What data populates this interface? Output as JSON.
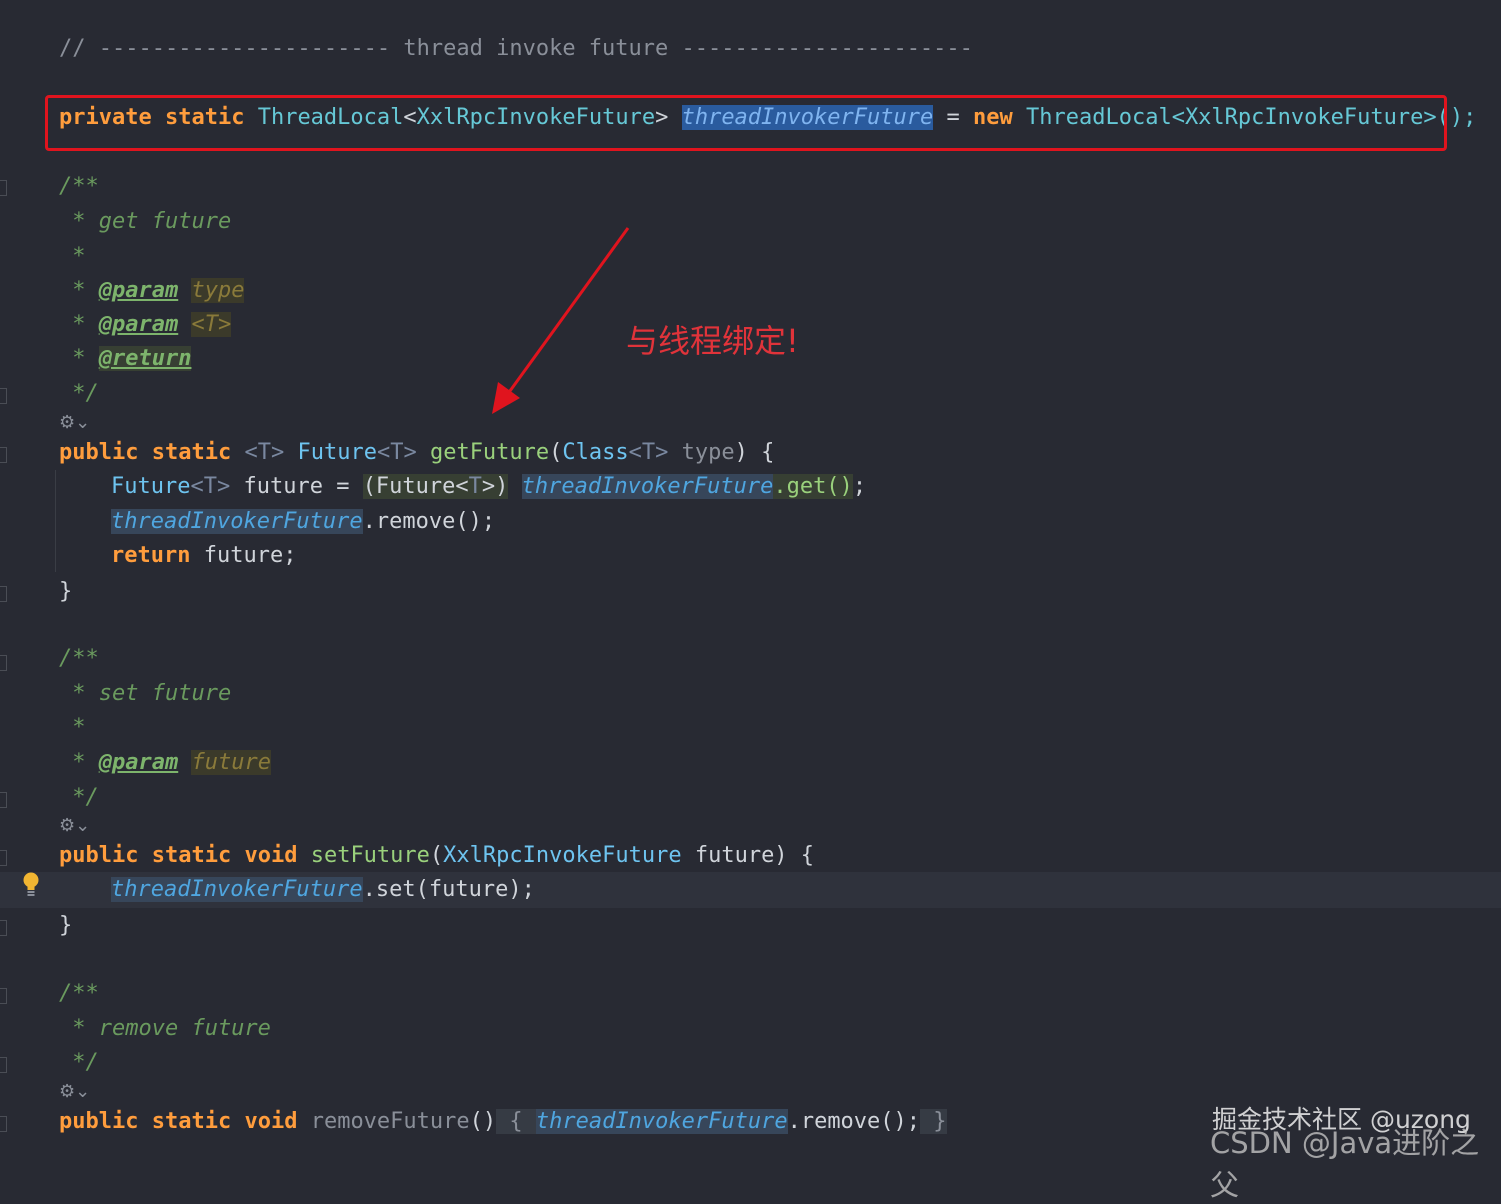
{
  "code": {
    "section_comment": "// ---------------------- thread invoke future ----------------------",
    "field_decl": {
      "kw_private": "private",
      "kw_static": "static",
      "type_name": "ThreadLocal",
      "type_arg_open": "<",
      "type_arg": "XxlRpcInvokeFuture",
      "type_arg_close": ">",
      "field_name": "threadInvokerFuture",
      "assign": " = ",
      "kw_new": "new",
      "ctor": "ThreadLocal<XxlRpcInvokeFuture>();"
    },
    "doc_open": "/**",
    "doc_get_desc": " * get future",
    "doc_star": " *",
    "doc_star_prefix": " * ",
    "tag_param": "@param",
    "tag_return": "@return",
    "param_type": "type",
    "param_T": "<T>",
    "doc_close": " */",
    "getFuture_sig": {
      "kw_public": "public",
      "kw_static": "static",
      "generic": "<T>",
      "ret_type": "Future",
      "ret_gen": "<T>",
      "name": "getFuture",
      "params_open": "(",
      "param_cls": "Class",
      "param_gen": "<T>",
      "param_name": " type",
      "params_close": ") {"
    },
    "getFuture_body": {
      "l1_type": "Future",
      "l1_gen": "<T>",
      "l1_var": " future = ",
      "l1_cast_open": "(Future<",
      "l1_cast_T": "T",
      "l1_cast_close": ">)",
      "field": "threadInvokerFuture",
      "l1_get": ".get()",
      "l1_end": ";",
      "l2_call": ".remove();",
      "l3_kw": "return",
      "l3_rest": " future;"
    },
    "close_brace": "}",
    "doc_set_desc": " * set future",
    "param_future": "future",
    "setFuture_sig": {
      "kw_public": "public",
      "kw_static": "static",
      "kw_void": "void",
      "name": "setFuture",
      "param_type": "XxlRpcInvokeFuture",
      "rest": " future) {"
    },
    "setFuture_body": {
      "field": "threadInvokerFuture",
      "call": ".set(future);"
    },
    "doc_remove_desc": " * remove future",
    "removeFuture_line": {
      "kw_public": "public",
      "kw_static": "static",
      "kw_void": "void",
      "name": "removeFuture",
      "parens": "()",
      "open": " { ",
      "field": "threadInvokerFuture",
      "call": ".remove();",
      "close": " }"
    }
  },
  "annotation": {
    "text": "与线程绑定!",
    "color": "#e0333a"
  },
  "watermark": {
    "line1": "掘金技术社区 @uzong",
    "line2": "CSDN @Java进阶之父"
  },
  "icons": {
    "gutter_icon": "override-method-icon",
    "bulb": "intention-bulb-icon"
  }
}
